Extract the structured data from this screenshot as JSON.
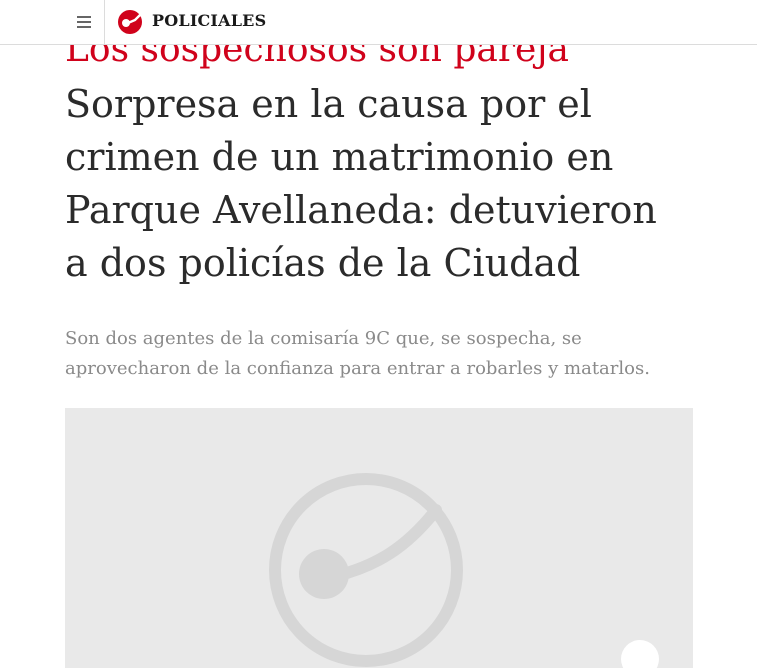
{
  "header": {
    "menu_icon": "hamburger-menu-icon",
    "logo_icon": "brand-logo-icon",
    "section_label": "POLICIALES",
    "accent_color": "#d0021b"
  },
  "article": {
    "kicker": "Los sospechosos son pareja",
    "headline": "Sorpresa en la causa por el crimen de un matrimonio en Parque Avellaneda: detuvieron a dos policías de la Ciudad",
    "summary": "Son dos agentes de la comisaría 9C que, se sospecha, se aprovecharon de la confianza para entrar a robarles y matarlos."
  },
  "media": {
    "placeholder_icon": "image-placeholder-logo-icon"
  }
}
